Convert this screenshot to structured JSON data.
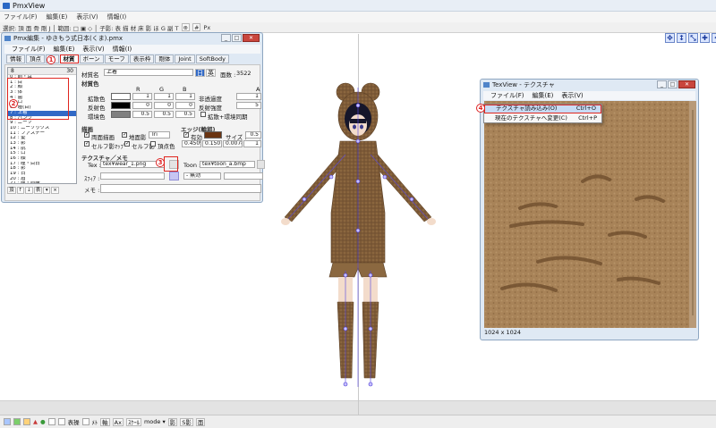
{
  "main": {
    "title": "PmxView",
    "menu": [
      "ファイル(F)",
      "編集(E)",
      "表示(V)",
      "情報(I)"
    ],
    "toolbar_text": "選択: 頂 面 骨 剛 J │ 範囲: □ ▣ ◇ │ 子影: 表 描 材 床 影 ほ G 副 T",
    "toolbar_px": "Px"
  },
  "status": {
    "items": [
      "表操",
      "ﾒﾄ",
      "軸",
      "Ax",
      "ｽｹｰﾙ",
      "mode",
      "影",
      "S影",
      "面"
    ],
    "mode_label": "mode ▾"
  },
  "pmx": {
    "title": "Pmx編集 - ゆきもう式日本(くま).pmx",
    "menu": [
      "ファイル(F)",
      "編集(E)",
      "表示(V)",
      "情報(I)"
    ],
    "tabs": [
      "情報",
      "頂点",
      "面",
      "材質",
      "ボーン",
      "モーフ",
      "表示枠",
      "剛体",
      "Joint",
      "SoftBody"
    ],
    "active_tab": "材質",
    "list_header_left": "8",
    "list_header_right": "30",
    "materials": [
      "0 : 前・耳",
      "1 : 目",
      "2 : 顔",
      "3 : 体",
      "4 : 歯",
      "5 : 口",
      "6 : 瞳(目)",
      "7 : 上着",
      "8 : パンツ",
      "9 : ニーソ",
      "10 : ニーソックス",
      "11 : ファスナー",
      "12 : 髪",
      "13 : 影",
      "14 : 肌",
      "15 : 口",
      "16 : 顔",
      "17 : 瞳・目白",
      "18 : 影",
      "19 : 白",
      "20 : 眉",
      "21 : 瞳・眉縁"
    ],
    "selected_index": 7,
    "list_buttons": [
      "頂",
      "↑",
      "↓",
      "表",
      "▾",
      "×"
    ],
    "mat_name_label": "材質名",
    "mat_name": "上着",
    "english_label": "英",
    "face_count_label": "面数 :",
    "face_count": "3522",
    "color_section": "材質色",
    "rgb_headers": [
      "R",
      "G",
      "B",
      "A"
    ],
    "diffuse_label": "拡散色",
    "diffuse": [
      "1",
      "1",
      "1",
      "1"
    ],
    "specular_label": "反射色",
    "specular": [
      "0",
      "0",
      "0"
    ],
    "ambient_label": "環境色",
    "ambient": [
      "0.5",
      "0.5",
      "0.5"
    ],
    "alpha_label": "非透過度",
    "spec_power_label": "反射強度",
    "spec_power": "5",
    "sphere_check_label": "拡散+環境同期",
    "draw_section": "描画",
    "draw_options": [
      "両面描画",
      "地面影",
      "セルフ影ﾏｯﾌﾟ",
      "セルフ影",
      "頂点色"
    ],
    "prim_type": "Tri",
    "edge_section": "エッジ(輪郭)",
    "edge_enabled_label": "有効",
    "edge_size_label": "サイズ :",
    "edge_size": "0.5",
    "edge_color": [
      "0.450980",
      "0.150784",
      "0.007843",
      "1"
    ],
    "edge_color_hex": "#6a3412",
    "texture_section": "テクスチャ／メモ",
    "tex_label": "Tex :",
    "tex_value": "tex¥wear_1.png",
    "toon_label": "Toon :",
    "toon_value": "tex¥toon_a.bmp",
    "sphere_label": "ｽﾌｨｱ :",
    "sphere_mode": "- 無効",
    "memo_label": "メモ :"
  },
  "texview": {
    "title": "TexView - テクスチャ",
    "menu": [
      "ファイル(F)",
      "編集(E)",
      "表示(V)"
    ],
    "dropdown": [
      {
        "label": "テクスチャ読み込み(O)",
        "shortcut": "Ctrl+O"
      },
      {
        "label": "現在のテクスチャへ変更(C)",
        "shortcut": "Ctrl+P"
      }
    ],
    "size": "1024 x 1024"
  },
  "badges": [
    "1",
    "2",
    "3",
    "4"
  ],
  "colors": {
    "highlight": "#e0261f",
    "selection": "#3169c6",
    "fabric": "#7d5a37",
    "window_frame": "#dfe9f4"
  }
}
